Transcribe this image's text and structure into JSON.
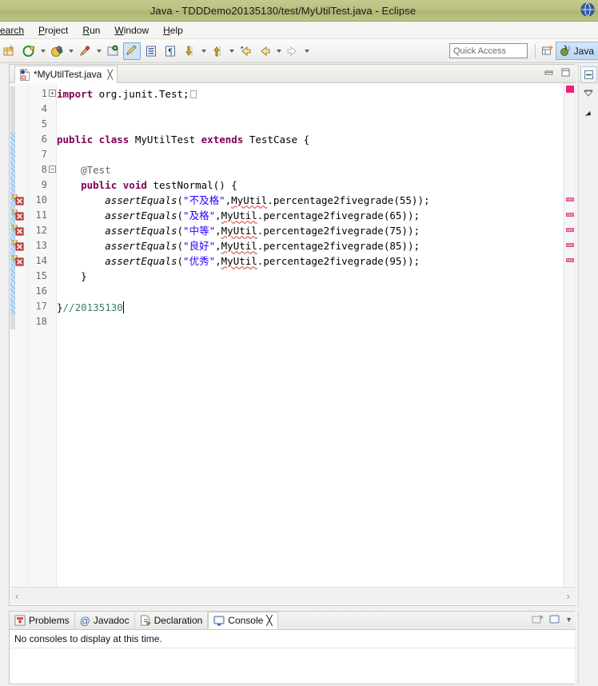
{
  "window": {
    "title": "Java - TDDDemo20135130/test/MyUtilTest.java - Eclipse"
  },
  "menubar": {
    "items": [
      {
        "label": "earch",
        "mnemonic": ""
      },
      {
        "label": "roject",
        "mnemonic": "P"
      },
      {
        "label": "un",
        "mnemonic": "R"
      },
      {
        "label": "indow",
        "mnemonic": "W"
      },
      {
        "label": "elp",
        "mnemonic": "H"
      }
    ]
  },
  "toolbar": {
    "icons": [
      "new-wizard-icon",
      "debug-icon",
      "debug-dropdown-icon",
      "run-icon",
      "run-dropdown-icon",
      "external-tools-icon",
      "new-java-package-icon",
      "new-java-class-icon",
      "open-type-icon",
      "next-annotation-icon",
      "next-annotation-dropdown-icon",
      "previous-annotation-icon",
      "previous-annotation-dropdown-icon",
      "last-edit-location-icon",
      "back-icon",
      "back-dropdown-icon",
      "forward-icon",
      "forward-dropdown-icon"
    ],
    "quick_access_placeholder": "Quick Access",
    "open_perspective_icon": "open-perspective-icon",
    "perspective_label": "Java"
  },
  "editor": {
    "tab": {
      "label": "*MyUtilTest.java",
      "dirty": true,
      "close_glyph": "╳",
      "file_icon": "java-file-error-icon"
    },
    "window_buttons": {
      "minimize": "minimize-icon",
      "maximize": "maximize-icon"
    },
    "caret_line": 17,
    "lines": [
      {
        "num": "1",
        "fold": "plus",
        "marker": "",
        "changed": false,
        "tokens": [
          {
            "t": "import",
            "c": "kw"
          },
          {
            "t": " org.junit.Test;",
            "c": "id"
          }
        ],
        "collapsed_box": true
      },
      {
        "num": "4",
        "fold": "",
        "marker": "",
        "changed": false,
        "tokens": []
      },
      {
        "num": "5",
        "fold": "",
        "marker": "",
        "changed": false,
        "tokens": []
      },
      {
        "num": "6",
        "fold": "",
        "marker": "",
        "changed": true,
        "tokens": [
          {
            "t": "public class ",
            "c": "kw"
          },
          {
            "t": "MyUtilTest ",
            "c": "id"
          },
          {
            "t": "extends ",
            "c": "kw"
          },
          {
            "t": "TestCase {",
            "c": "id"
          }
        ]
      },
      {
        "num": "7",
        "fold": "",
        "marker": "",
        "changed": true,
        "tokens": []
      },
      {
        "num": "8",
        "fold": "minus",
        "marker": "",
        "changed": true,
        "tokens": [
          {
            "t": "    @Test",
            "c": "ann"
          }
        ]
      },
      {
        "num": "9",
        "fold": "",
        "marker": "",
        "changed": true,
        "tokens": [
          {
            "t": "    public void ",
            "c": "kw"
          },
          {
            "t": "testNormal() {",
            "c": "id"
          }
        ]
      },
      {
        "num": "10",
        "fold": "",
        "marker": "error",
        "changed": true,
        "tokens": [
          {
            "t": "        assertEquals",
            "c": "mth"
          },
          {
            "t": "(",
            "c": "id"
          },
          {
            "t": "\"不及格\"",
            "c": "str"
          },
          {
            "t": ",",
            "c": "id"
          },
          {
            "t": "MyUtil",
            "c": "sq"
          },
          {
            "t": ".percentage2fivegrade(55));",
            "c": "id"
          }
        ]
      },
      {
        "num": "11",
        "fold": "",
        "marker": "error",
        "changed": true,
        "tokens": [
          {
            "t": "        assertEquals",
            "c": "mth"
          },
          {
            "t": "(",
            "c": "id"
          },
          {
            "t": "\"及格\"",
            "c": "str"
          },
          {
            "t": ",",
            "c": "id"
          },
          {
            "t": "MyUtil",
            "c": "sq"
          },
          {
            "t": ".percentage2fivegrade(65));",
            "c": "id"
          }
        ]
      },
      {
        "num": "12",
        "fold": "",
        "marker": "error",
        "changed": true,
        "tokens": [
          {
            "t": "        assertEquals",
            "c": "mth"
          },
          {
            "t": "(",
            "c": "id"
          },
          {
            "t": "\"中等\"",
            "c": "str"
          },
          {
            "t": ",",
            "c": "id"
          },
          {
            "t": "MyUtil",
            "c": "sq"
          },
          {
            "t": ".percentage2fivegrade(75));",
            "c": "id"
          }
        ]
      },
      {
        "num": "13",
        "fold": "",
        "marker": "error",
        "changed": true,
        "tokens": [
          {
            "t": "        assertEquals",
            "c": "mth"
          },
          {
            "t": "(",
            "c": "id"
          },
          {
            "t": "\"良好\"",
            "c": "str"
          },
          {
            "t": ",",
            "c": "id"
          },
          {
            "t": "MyUtil",
            "c": "sq"
          },
          {
            "t": ".percentage2fivegrade(85));",
            "c": "id"
          }
        ]
      },
      {
        "num": "14",
        "fold": "",
        "marker": "error",
        "changed": true,
        "tokens": [
          {
            "t": "        assertEquals",
            "c": "mth"
          },
          {
            "t": "(",
            "c": "id"
          },
          {
            "t": "\"优秀\"",
            "c": "str"
          },
          {
            "t": ",",
            "c": "id"
          },
          {
            "t": "MyUtil",
            "c": "sq"
          },
          {
            "t": ".percentage2fivegrade(95));",
            "c": "id"
          }
        ]
      },
      {
        "num": "15",
        "fold": "",
        "marker": "",
        "changed": true,
        "tokens": [
          {
            "t": "    }",
            "c": "id"
          }
        ]
      },
      {
        "num": "16",
        "fold": "",
        "marker": "",
        "changed": true,
        "tokens": []
      },
      {
        "num": "17",
        "fold": "",
        "marker": "",
        "changed": true,
        "current": true,
        "tokens": [
          {
            "t": "}",
            "c": "id"
          },
          {
            "t": "//20135130",
            "c": "cmt"
          }
        ]
      },
      {
        "num": "18",
        "fold": "",
        "marker": "",
        "changed": false,
        "tokens": []
      }
    ],
    "overview_ruler": {
      "top_marker_color": "#f2217a",
      "marker_color": "#fb7fc0",
      "marker_lines": [
        10,
        11,
        12,
        13,
        14
      ]
    },
    "h_scroll": {
      "left_glyph": "‹",
      "right_glyph": "›"
    }
  },
  "side_toolbar": {
    "buttons": [
      "restore-view-icon",
      "minimize-view-icon",
      "fast-view-icon"
    ]
  },
  "bottom_panel": {
    "tabs": [
      {
        "label": "Problems",
        "icon": "problems-icon",
        "active": false
      },
      {
        "label": "Javadoc",
        "icon": "javadoc-at-icon",
        "active": false
      },
      {
        "label": "Declaration",
        "icon": "declaration-icon",
        "active": false
      },
      {
        "label": "Console",
        "icon": "console-icon",
        "active": true,
        "close_glyph": "╳"
      }
    ],
    "window_buttons": [
      "open-console-icon",
      "display-selected-console-icon",
      "console-menu-arrow"
    ],
    "console_message": "No consoles to display at this time."
  }
}
